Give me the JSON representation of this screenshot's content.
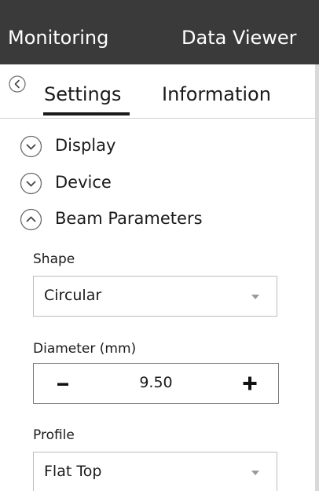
{
  "topnav": {
    "items": [
      {
        "label": "Monitoring"
      },
      {
        "label": "Data Viewer"
      }
    ]
  },
  "tabs": {
    "items": [
      {
        "label": "Settings",
        "active": true
      },
      {
        "label": "Information",
        "active": false
      }
    ]
  },
  "sections": [
    {
      "label": "Display",
      "expanded": false
    },
    {
      "label": "Device",
      "expanded": false
    },
    {
      "label": "Beam Parameters",
      "expanded": true
    }
  ],
  "beam": {
    "shape": {
      "label": "Shape",
      "value": "Circular"
    },
    "diameter": {
      "label": "Diameter (mm)",
      "value": "9.50"
    },
    "profile": {
      "label": "Profile",
      "value": "Flat Top"
    }
  },
  "colors": {
    "topbar_bg": "#3a3a3a",
    "topbar_text": "#ffffff",
    "border": "#bdbdbd"
  },
  "icons": {
    "back": "chevron-left-circle-icon",
    "collapsed": "chevron-down-circle-icon",
    "expanded": "chevron-up-circle-icon",
    "dropdown": "caret-down-icon",
    "decrement": "minus-icon",
    "increment": "plus-icon"
  }
}
